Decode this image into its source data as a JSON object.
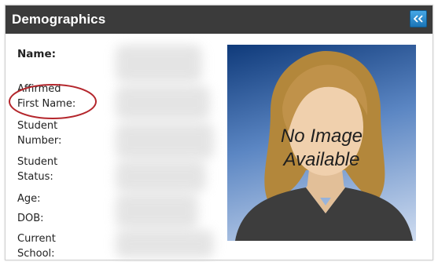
{
  "panel": {
    "title": "Demographics",
    "collapse_icon": "double-chevron-left-icon"
  },
  "fields": [
    {
      "label": "Name:"
    },
    {
      "label": "Affirmed\nFirst Name:"
    },
    {
      "label": "Student\nNumber:"
    },
    {
      "label": "Student\nStatus:"
    },
    {
      "label": "Age:"
    },
    {
      "label": "DOB:"
    },
    {
      "label": "Current\nSchool:"
    }
  ],
  "photo": {
    "line1": "No Image",
    "line2": "Available"
  },
  "colors": {
    "header_bg": "#3b3b3b",
    "accent_button": "#1b74b6",
    "highlight": "#b4262c"
  }
}
